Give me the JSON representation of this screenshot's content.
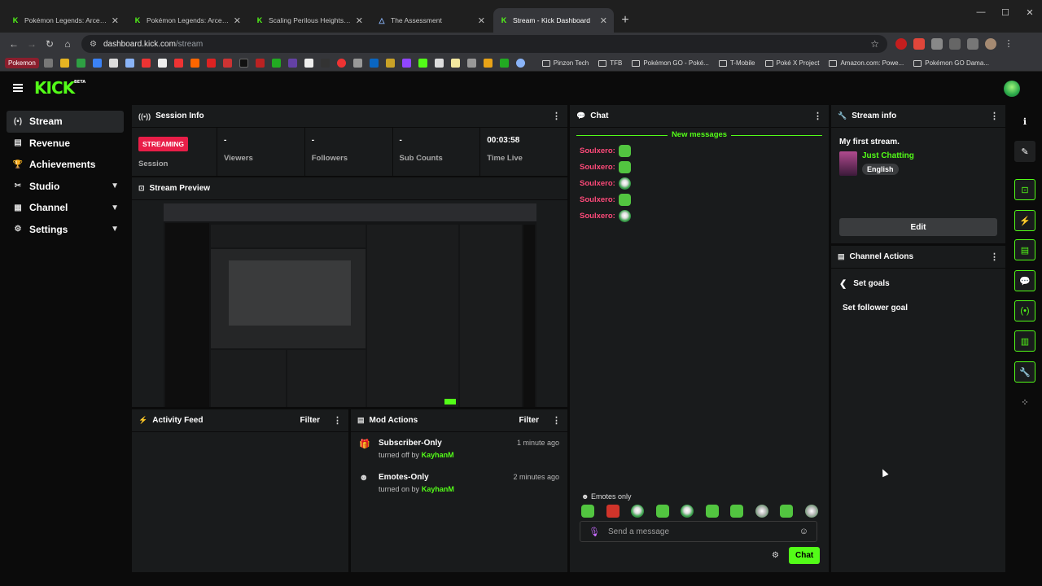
{
  "browser": {
    "tabs": [
      {
        "title": "Pokémon Legends: Arceus - Ite",
        "favicon": "K",
        "color": "#53fc18"
      },
      {
        "title": "Pokémon Legends: Arceus - Re",
        "favicon": "K",
        "color": "#53fc18"
      },
      {
        "title": "Scaling Perilous Heights - Miss",
        "favicon": "K",
        "color": "#53fc18"
      },
      {
        "title": "The Assessment",
        "favicon": "△",
        "color": "#8ab4f8"
      },
      {
        "title": "Stream - Kick Dashboard",
        "favicon": "K",
        "color": "#53fc18"
      }
    ],
    "active_tab": 4,
    "url_host": "dashboard.kick.com",
    "url_path": "/stream",
    "bookmarks_first": "Pokemon",
    "bookmark_folders": [
      "Pinzon Tech",
      "TFB",
      "Pokémon GO - Poké...",
      "T-Mobile",
      "Poké X Project",
      "Amazon.com: Powe...",
      "Pokémon GO Dama..."
    ]
  },
  "app": {
    "logo": "KICK",
    "logo_beta": "BETA",
    "nav": [
      {
        "label": "Stream",
        "icon": "stream-icon",
        "glyph": "(•)",
        "active": true,
        "expandable": false
      },
      {
        "label": "Revenue",
        "icon": "revenue-icon",
        "glyph": "▤",
        "active": false,
        "expandable": false
      },
      {
        "label": "Achievements",
        "icon": "trophy-icon",
        "glyph": "🏆",
        "active": false,
        "expandable": false
      },
      {
        "label": "Studio",
        "icon": "studio-icon",
        "glyph": "✂",
        "active": false,
        "expandable": true
      },
      {
        "label": "Channel",
        "icon": "channel-icon",
        "glyph": "▦",
        "active": false,
        "expandable": true
      },
      {
        "label": "Settings",
        "icon": "gear-icon",
        "glyph": "⚙",
        "active": false,
        "expandable": true
      }
    ]
  },
  "session": {
    "title": "Session Info",
    "badge": "STREAMING",
    "session_label": "Session",
    "stats": [
      {
        "value": "-",
        "label": "Viewers"
      },
      {
        "value": "-",
        "label": "Followers"
      },
      {
        "value": "-",
        "label": "Sub Counts"
      },
      {
        "value": "00:03:58",
        "label": "Time Live"
      }
    ]
  },
  "preview": {
    "title": "Stream Preview"
  },
  "activity": {
    "title": "Activity Feed",
    "filter": "Filter"
  },
  "mod": {
    "title": "Mod Actions",
    "filter": "Filter",
    "items": [
      {
        "action": "Subscriber-Only",
        "detail": "turned off by",
        "user": "KayhanM",
        "time": "1 minute ago"
      },
      {
        "action": "Emotes-Only",
        "detail": "turned on by",
        "user": "KayhanM",
        "time": "2 minutes ago"
      }
    ]
  },
  "chat": {
    "title": "Chat",
    "new_messages": "New messages",
    "messages": [
      {
        "user": "Soulxero:",
        "emote": "em-green"
      },
      {
        "user": "Soulxero:",
        "emote": "em-green"
      },
      {
        "user": "Soulxero:",
        "emote": "em-ball"
      },
      {
        "user": "Soulxero:",
        "emote": "em-green"
      },
      {
        "user": "Soulxero:",
        "emote": "em-ball"
      }
    ],
    "emotes_only": "Emotes only",
    "emote_bar": [
      "em-green",
      "em-red",
      "em-ball",
      "em-green",
      "em-ball",
      "em-green",
      "em-green",
      "em-skull",
      "em-green",
      "em-skull"
    ],
    "placeholder": "Send a message",
    "send": "Chat"
  },
  "stream_info": {
    "title": "Stream info",
    "stream_title": "My first stream.",
    "category": "Just Chatting",
    "language": "English",
    "edit": "Edit"
  },
  "channel_actions": {
    "title": "Channel Actions",
    "back_label": "Set goals",
    "item": "Set follower goal"
  },
  "rail": [
    {
      "name": "info-icon",
      "glyph": "ℹ",
      "style": "plain"
    },
    {
      "name": "pencil-icon",
      "glyph": "✎",
      "style": "dark"
    },
    {
      "name": "scan-icon",
      "glyph": "⊡",
      "style": "boxed"
    },
    {
      "name": "lightning-icon",
      "glyph": "⚡",
      "style": "boxed"
    },
    {
      "name": "document-icon",
      "glyph": "▤",
      "style": "boxed"
    },
    {
      "name": "chat-bubble-icon",
      "glyph": "💬",
      "style": "boxed"
    },
    {
      "name": "broadcast-icon",
      "glyph": "(•)",
      "style": "boxed"
    },
    {
      "name": "layout-icon",
      "glyph": "▥",
      "style": "boxed"
    },
    {
      "name": "wrench-icon",
      "glyph": "🔧",
      "style": "boxed"
    },
    {
      "name": "dots-icon",
      "glyph": "⁘",
      "style": "plain"
    }
  ]
}
